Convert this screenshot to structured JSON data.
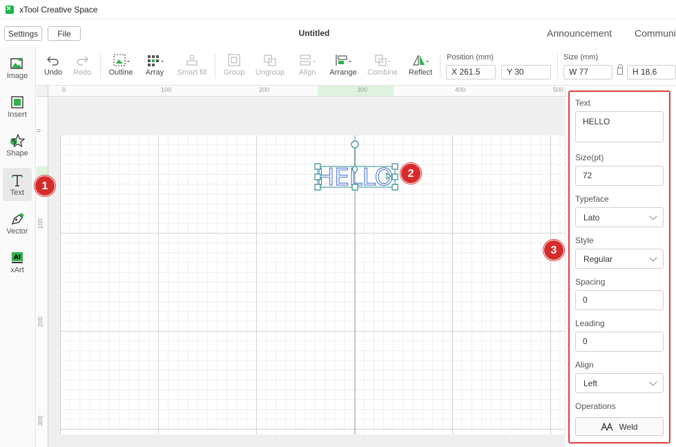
{
  "app": {
    "title": "xTool Creative Space",
    "document_title": "Untitled"
  },
  "menu": {
    "settings": "Settings",
    "file": "File"
  },
  "top_links": {
    "announcement": "Announcement",
    "community": "Communi"
  },
  "sidebar": {
    "items": [
      {
        "label": "Image",
        "icon": "image-icon"
      },
      {
        "label": "Insert",
        "icon": "insert-icon"
      },
      {
        "label": "Shape",
        "icon": "shape-icon"
      },
      {
        "label": "Text",
        "icon": "text-icon",
        "active": true
      },
      {
        "label": "Vector",
        "icon": "pen-icon"
      },
      {
        "label": "xArt",
        "icon": "ai-icon"
      }
    ]
  },
  "toolbar": {
    "undo": "Undo",
    "redo": "Redo",
    "outline": "Outline",
    "array": "Array",
    "smart_fill": "Smart fill",
    "group": "Group",
    "ungroup": "Ungroup",
    "align": "Align",
    "arrange": "Arrange",
    "combine": "Combine",
    "reflect": "Reflect",
    "position_label": "Position (mm)",
    "x_value": "X 261.5",
    "y_value": "Y 30",
    "size_label": "Size (mm)",
    "w_value": "W 77",
    "h_value": "H 18.6"
  },
  "ruler": {
    "top_ticks": [
      "0",
      "100",
      "200",
      "300",
      "400",
      "500"
    ],
    "left_ticks": [
      "0",
      "100",
      "200",
      "300"
    ]
  },
  "canvas": {
    "text_object": "HELLO"
  },
  "properties": {
    "text_label": "Text",
    "text_value": "HELLO",
    "size_label": "Size(pt)",
    "size_value": "72",
    "typeface_label": "Typeface",
    "typeface_value": "Lato",
    "style_label": "Style",
    "style_value": "Regular",
    "spacing_label": "Spacing",
    "spacing_value": "0",
    "leading_label": "Leading",
    "leading_value": "0",
    "align_label": "Align",
    "align_value": "Left",
    "operations_label": "Operations",
    "weld_label": "Weld"
  },
  "callouts": [
    "1",
    "2",
    "3"
  ],
  "colors": {
    "accent_green": "#19b44a",
    "callout_red": "#d62b2b",
    "selection_teal": "#2b8a8a",
    "text_outline_blue": "#3a6fd0"
  }
}
